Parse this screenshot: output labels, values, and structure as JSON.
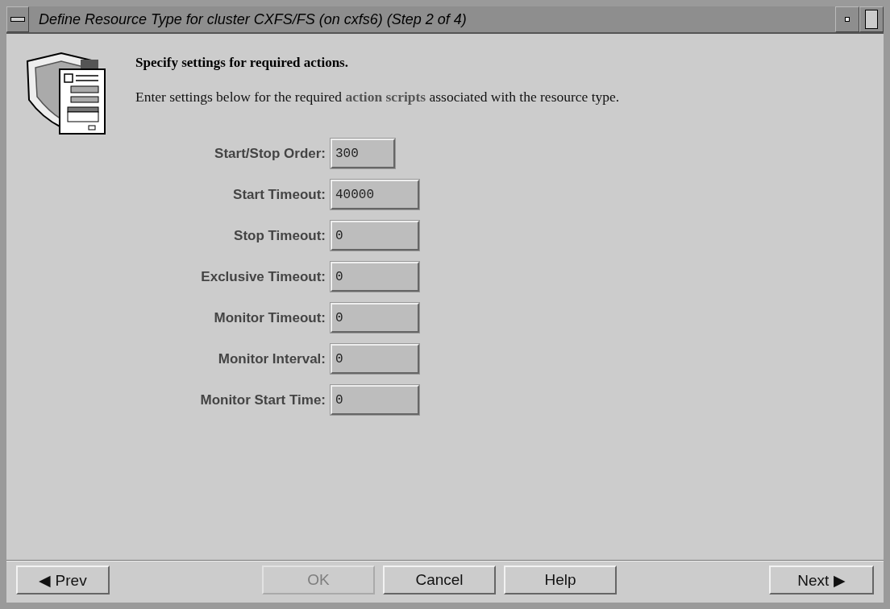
{
  "window": {
    "title": "Define Resource Type for cluster CXFS/FS (on cxfs6) (Step 2 of 4)"
  },
  "heading": "Specify settings for required actions.",
  "description": "Enter settings below for the required **action scripts** associated with the resource type.",
  "fields": [
    {
      "label": "Start/Stop Order:",
      "value": "300"
    },
    {
      "label": "Start Timeout:",
      "value": "40000"
    },
    {
      "label": "Stop Timeout:",
      "value": "0"
    },
    {
      "label": "Exclusive Timeout:",
      "value": "0"
    },
    {
      "label": "Monitor Timeout:",
      "value": "0"
    },
    {
      "label": "Monitor Interval:",
      "value": "0"
    },
    {
      "label": "Monitor Start Time:",
      "value": "0"
    }
  ],
  "buttons": [
    {
      "label": "◀ Prev",
      "disabled": false
    },
    {
      "label": "OK",
      "disabled": true
    },
    {
      "label": "Cancel",
      "disabled": false
    },
    {
      "label": "Help",
      "disabled": false
    },
    {
      "label": "Next ▶",
      "disabled": false
    }
  ]
}
